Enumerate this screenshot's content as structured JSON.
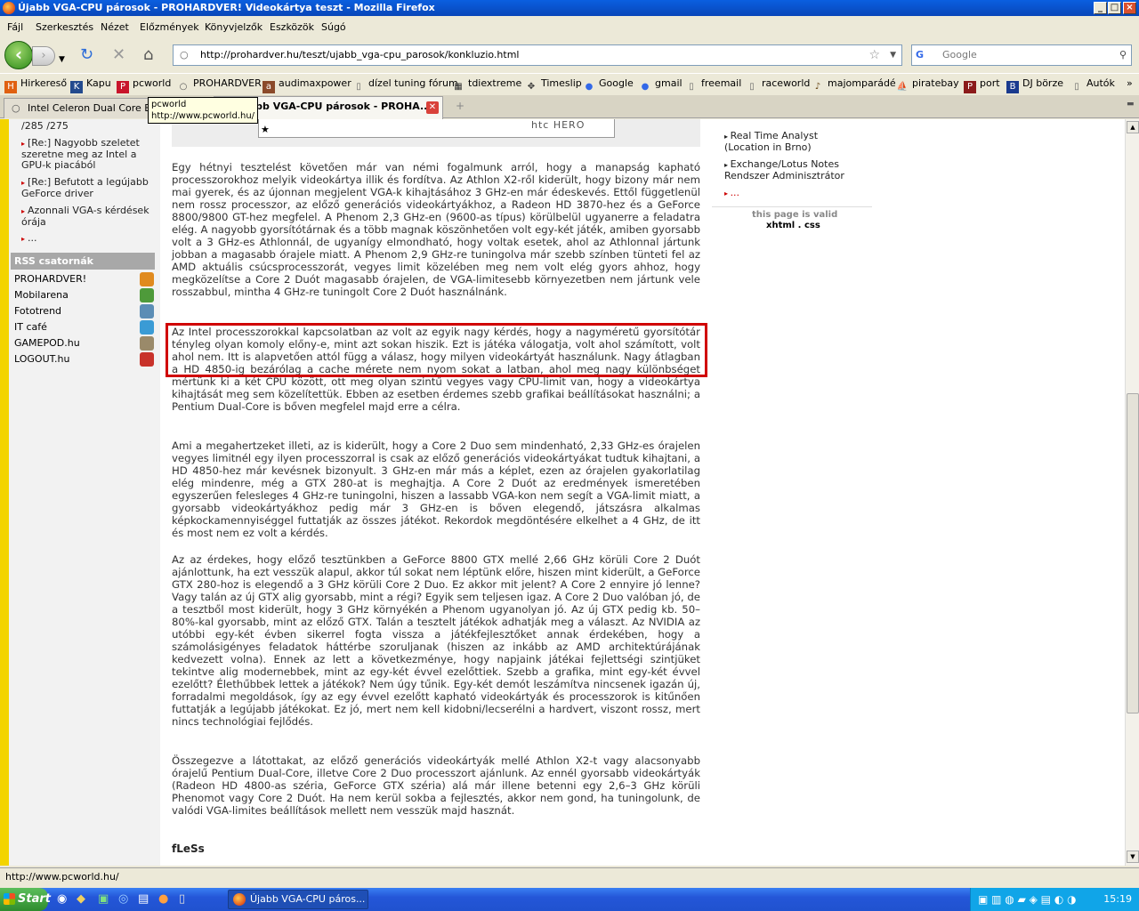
{
  "window": {
    "title": "Újabb VGA-CPU párosok - PROHARDVER! Videokártya teszt - Mozilla Firefox"
  },
  "menu": [
    "Fájl",
    "Szerkesztés",
    "Nézet",
    "Előzmények",
    "Könyvjelzők",
    "Eszközök",
    "Súgó"
  ],
  "nav": {
    "url": "http://prohardver.hu/teszt/ujabb_vga-cpu_parosok/konkluzio.html",
    "search_placeholder": "Google"
  },
  "bookmarks": [
    "Hirkereső",
    "Kapu",
    "pcworld",
    "PROHARDVER",
    "audimaxpower",
    "dízel tuning fórum",
    "tdiextreme",
    "Timeslip",
    "Google",
    "gmail",
    "freemail",
    "raceworld",
    "majomparádé",
    "piratebay",
    "port",
    "DJ börze",
    "Autók"
  ],
  "tabs": [
    {
      "label": "Intel Celeron Dual Core E3000"
    },
    {
      "label": "Újabb VGA-CPU párosok - PROHA..."
    }
  ],
  "tooltip": {
    "line1": "pcworld",
    "line2": "http://www.pcworld.hu/"
  },
  "left": {
    "news": [
      "/285 /275",
      "[Re:] Nagyobb szeletet szeretne meg az Intel a GPU-k piacából",
      "[Re:] Befutott a legújabb GeForce driver",
      "Azonnali VGA-s kérdések órája",
      "..."
    ],
    "rss_title": "RSS csatornák",
    "rss": [
      "PROHARDVER!",
      "Mobilarena",
      "Fototrend",
      "IT café",
      "GAMEPOD.hu",
      "LOGOUT.hu"
    ]
  },
  "banner": {
    "brand": "htc HERO"
  },
  "article": {
    "p1": "Egy hétnyi tesztelést követően már van némi fogalmunk arról, hogy a manapság kapható processzorokhoz melyik videokártya illik és fordítva. Az Athlon X2-ről kiderült, hogy bizony már nem mai gyerek, és az újonnan megjelent VGA-k kihajtásához 3 GHz-en már édeskevés. Ettől függetlenül nem rossz processzor, az előző generációs videokártyákhoz, a Radeon HD 3870-hez és a GeForce 8800/9800 GT-hez megfelel. A Phenom 2,3 GHz-en (9600-as típus) körülbelül ugyanerre a feladatra elég. A nagyobb gyorsítótárnak és a több magnak köszönhetően volt egy-két játék, amiben gyorsabb volt a 3 GHz-es Athlonnál, de ugyanígy elmondható, hogy voltak esetek, ahol az Athlonnal jártunk jobban a magasabb órajele miatt. A Phenom 2,9 GHz-re tuningolva már szebb színben tünteti fel az AMD aktuális csúcsprocesszorát, vegyes limit közelében meg nem volt elég gyors ahhoz, hogy megközelítse a Core 2 Duót magasabb órajelen, de VGA-limitesebb környezetben nem jártunk vele rosszabbul, mintha 4 GHz-re tuningolt Core 2 Duót használnánk.",
    "p2": "Az Intel processzorokkal kapcsolatban az volt az egyik nagy kérdés, hogy a nagyméretű gyorsítótár tényleg olyan komoly előny-e, mint azt sokan hiszik. Ezt is játéka válogatja, volt ahol számított, volt ahol nem. Itt is alapvetően attól függ a válasz, hogy milyen videokártyát használunk. Nagy átlagban a HD 4850-ig bezárólag a cache mérete nem nyom sokat a latban, ahol meg nagy különbséget mértünk ki a két CPU között, ott meg olyan szintű vegyes vagy CPU-limit van, hogy a videokártya kihajtását meg sem közelítettük. Ebben az esetben érdemes szebb grafikai beállításokat használni; a Pentium Dual-Core is bőven megfelel majd erre a célra.",
    "p3": "Ami a megahertzeket illeti, az is kiderült, hogy a Core 2 Duo sem mindenható, 2,33 GHz-es órajelen vegyes limitnél egy ilyen processzorral is csak az előző generációs videokártyákat tudtuk kihajtani, a HD 4850-hez már kevésnek bizonyult. 3 GHz-en már más a képlet, ezen az órajelen gyakorlatilag elég mindenre, még a GTX 280-at is meghajtja. A Core 2 Duót az eredmények ismeretében egyszerűen felesleges 4 GHz-re tuningolni, hiszen a lassabb VGA-kon nem segít a VGA-limit miatt, a gyorsabb videokártyákhoz pedig már 3 GHz-en is bőven elegendő, játszásra alkalmas képkockamennyiséggel futtatják az összes játékot. Rekordok megdöntésére elkelhet a 4 GHz, de itt és most nem ez volt a kérdés.",
    "p4": "Az az érdekes, hogy előző tesztünkben a GeForce 8800 GTX mellé 2,66 GHz körüli Core 2 Duót ajánlottunk, ha ezt vesszük alapul, akkor túl sokat nem léptünk előre, hiszen mint kiderült, a GeForce GTX 280-hoz is elegendő a 3 GHz körüli Core 2 Duo. Ez akkor mit jelent? A Core 2 ennyire jó lenne? Vagy talán az új GTX alig gyorsabb, mint a régi? Egyik sem teljesen igaz. A Core 2 Duo valóban jó, de a tesztből most kiderült, hogy 3 GHz környékén a Phenom ugyanolyan jó. Az új GTX pedig kb. 50–80%-kal gyorsabb, mint az előző GTX. Talán a tesztelt játékok adhatják meg a választ. Az NVIDIA az utóbbi egy-két évben sikerrel fogta vissza a játékfejlesztőket annak érdekében, hogy a számolásigényes feladatok háttérbe szoruljanak (hiszen az inkább az AMD architektúrájának kedvezett volna). Ennek az lett a következménye, hogy napjaink játékai fejlettségi szintjüket tekintve alig modernebbek, mint az egy-két évvel ezelőttiek. Szebb a grafika, mint egy-két évvel ezelőtt? Élethűbbek lettek a játékok? Nem úgy tűnik. Egy-két demót leszámítva nincsenek igazán új, forradalmi megoldások, így az egy évvel ezelőtt kapható videokártyák és processzorok is kitűnően futtatják a legújabb játékokat. Ez jó, mert nem kell kidobni/lecserélni a hardvert, viszont rossz, mert nincs technológiai fejlődés.",
    "p5": "Összegezve a látottakat, az előző generációs videokártyák mellé Athlon X2-t vagy alacsonyabb órajelű Pentium Dual-Core, illetve Core 2 Duo processzort ajánlunk. Az ennél gyorsabb videokártyák (Radeon HD 4800-as széria, GeForce GTX széria) alá már illene betenni egy 2,6–3 GHz körüli Phenomot vagy Core 2 Duót. Ha nem kerül sokba a fejlesztés, akkor nem gond, ha tuningolunk, de valódi VGA-limites beállítások mellett nem vesszük majd hasznát.",
    "author": "fLeSs"
  },
  "right": {
    "links": [
      "Real Time Analyst (Location in Brno)",
      "Exchange/Lotus Notes Rendszer Adminisztrátor",
      "..."
    ],
    "valid_label": "this page is valid",
    "valid_links": "xhtml . css"
  },
  "status": {
    "text": "http://www.pcworld.hu/"
  },
  "taskbar": {
    "start": "Start",
    "item": "Újabb VGA-CPU páros...",
    "clock": "15:19"
  },
  "colors": {
    "highlight": "#D00000",
    "accent_strip": "#F3D400"
  }
}
